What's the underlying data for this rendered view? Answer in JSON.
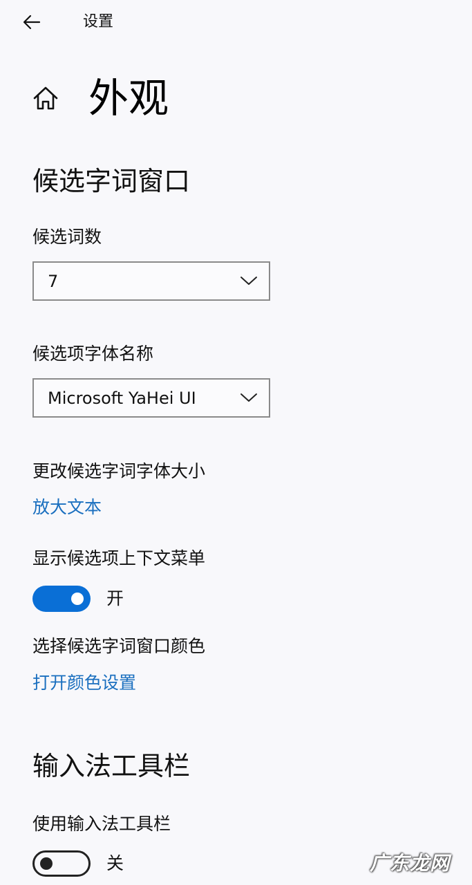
{
  "window": {
    "title": "设置"
  },
  "page": {
    "title": "外观"
  },
  "candidate_window": {
    "section_title": "候选字词窗口",
    "count_label": "候选词数",
    "count_value": "7",
    "font_label": "候选项字体名称",
    "font_value": "Microsoft YaHei UI",
    "font_size_label": "更改候选字词字体大小",
    "font_size_link": "放大文本",
    "context_menu_label": "显示候选项上下文菜单",
    "context_menu_state": "开",
    "context_menu_on": true,
    "color_label": "选择候选字词窗口颜色",
    "color_link": "打开颜色设置"
  },
  "toolbar": {
    "section_title": "输入法工具栏",
    "use_label": "使用输入法工具栏",
    "use_state": "关",
    "use_on": false
  },
  "watermark": {
    "text": "广东龙网"
  },
  "colors": {
    "accent": "#0a6fd6",
    "link": "#1a6fbf",
    "background": "#f8f8fb"
  },
  "icons": {
    "back": "arrow-left-icon",
    "home": "home-icon",
    "dropdown": "chevron-down-icon"
  }
}
